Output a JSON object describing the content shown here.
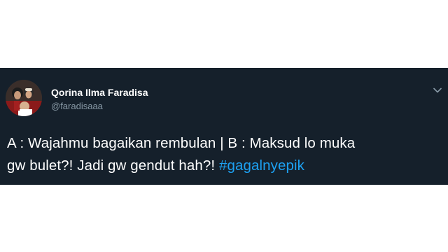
{
  "tweet": {
    "author_name": "Qorina Ilma Faradisa",
    "author_handle": "@faradisaaa",
    "text_line1": "A : Wajahmu bagaikan rembulan | B : Maksud lo muka",
    "text_line2": "gw bulet?! Jadi gw gendut hah?! ",
    "hashtag": "#gagalnyepik"
  },
  "icons": {
    "menu": "chevron-down-icon",
    "avatar": "profile-photo"
  },
  "colors": {
    "card_background": "#15202b",
    "text": "#ffffff",
    "handle": "#8899a6",
    "hashtag": "#1da1f2"
  }
}
